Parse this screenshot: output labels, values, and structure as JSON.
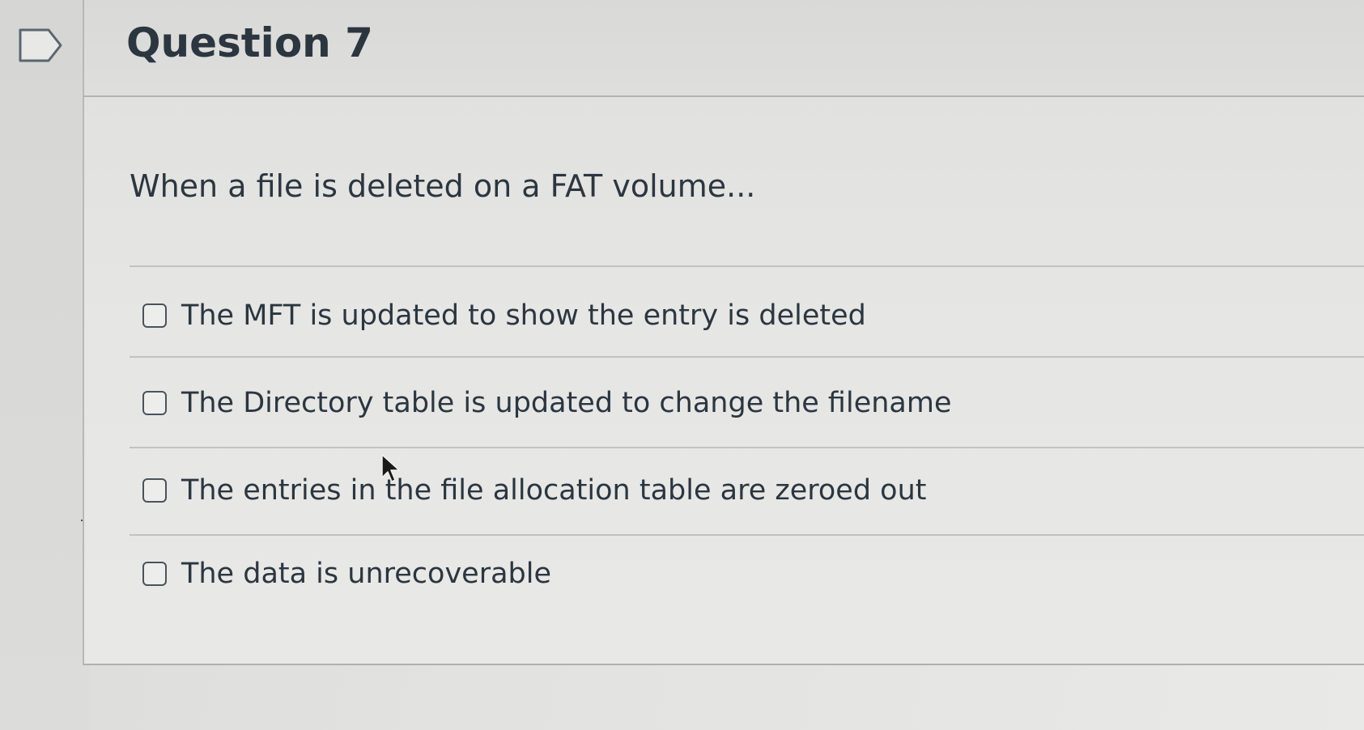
{
  "question": {
    "title": "Question 7",
    "text": "When a file is deleted on a FAT volume...",
    "flag_icon": "flag-question-icon",
    "answers": [
      {
        "label": "The MFT is updated to show the entry is deleted",
        "checked": false
      },
      {
        "label": "The Directory table is updated to change the filename",
        "checked": false
      },
      {
        "label": "The entries in the file allocation table are zeroed out",
        "checked": false
      },
      {
        "label": "The data is unrecoverable",
        "checked": false
      }
    ]
  },
  "colors": {
    "text": "#2b3640",
    "border": "#b3b3b1",
    "background": "#e4e4e2"
  }
}
